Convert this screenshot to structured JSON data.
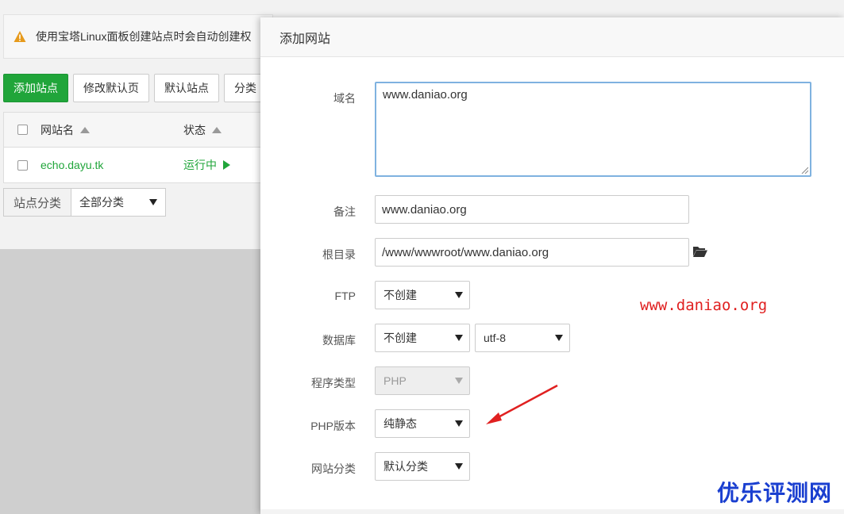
{
  "background": {
    "notice_text": "使用宝塔Linux面板创建站点时会自动创建权",
    "buttons": [
      "添加站点",
      "修改默认页",
      "默认站点",
      "分类"
    ],
    "table": {
      "headers": {
        "name": "网站名",
        "status": "状态"
      },
      "rows": [
        {
          "name": "echo.dayu.tk",
          "status": "运行中"
        }
      ]
    },
    "category_label": "站点分类",
    "category_value": "全部分类"
  },
  "modal": {
    "title": "添加网站",
    "fields": {
      "domain": {
        "label": "域名",
        "value": "www.daniao.org"
      },
      "remark": {
        "label": "备注",
        "value": "www.daniao.org"
      },
      "root": {
        "label": "根目录",
        "value": "/www/wwwroot/www.daniao.org"
      },
      "ftp": {
        "label": "FTP",
        "value": "不创建"
      },
      "database": {
        "label": "数据库",
        "value": "不创建",
        "charset": "utf-8"
      },
      "program": {
        "label": "程序类型",
        "value": "PHP"
      },
      "php_version": {
        "label": "PHP版本",
        "value": "纯静态"
      },
      "site_category": {
        "label": "网站分类",
        "value": "默认分类"
      }
    }
  },
  "annotations": {
    "url_watermark": "www.daniao.org",
    "brand_watermark": "优乐评测网",
    "arrow_color": "#e02020"
  },
  "colors": {
    "primary_green": "#20a53a",
    "focus_blue": "#7fb2e0"
  }
}
